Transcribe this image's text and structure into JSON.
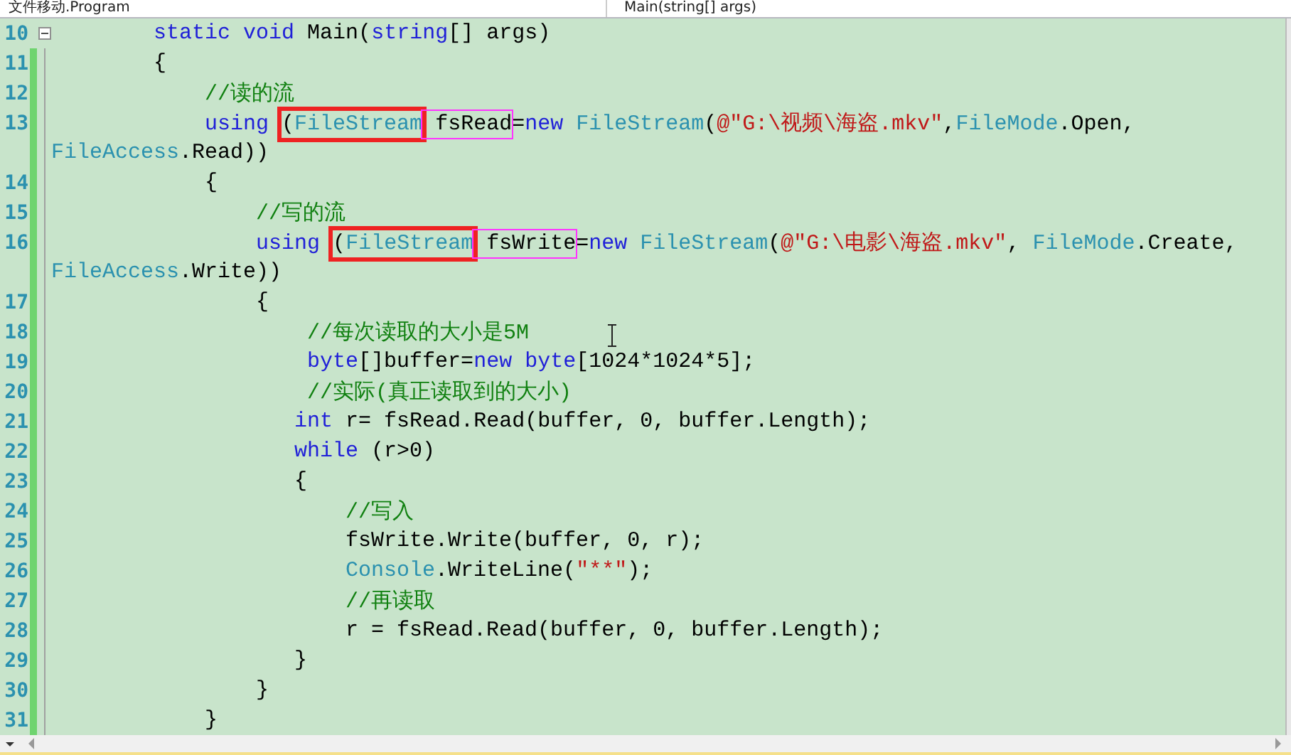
{
  "navigation_bar": {
    "type_dropdown": "文件移动.Program",
    "member_dropdown": "Main(string[] args)"
  },
  "code_rows": [
    {
      "number": "10",
      "collapsible": true,
      "modified": false,
      "tokens": [
        {
          "kind": "keyword",
          "text": "        static "
        },
        {
          "kind": "keyword",
          "text": "void"
        },
        {
          "kind": "plain",
          "text": " Main("
        },
        {
          "kind": "keyword",
          "text": "string"
        },
        {
          "kind": "plain",
          "text": "[] args)"
        }
      ]
    },
    {
      "number": "11",
      "collapsible": false,
      "modified": true,
      "tokens": [
        {
          "kind": "plain",
          "text": "        {"
        }
      ]
    },
    {
      "number": "12",
      "collapsible": false,
      "modified": true,
      "tokens": [
        {
          "kind": "comment",
          "text": "            //读的流"
        }
      ]
    },
    {
      "number": "13",
      "collapsible": false,
      "modified": true,
      "tokens": [
        {
          "kind": "keyword",
          "text": "            using "
        },
        {
          "kind": "frame",
          "color": "#ee2222",
          "tokens": [
            {
              "kind": "plain",
              "text": "("
            },
            {
              "kind": "type",
              "text": "FileStream"
            }
          ]
        },
        {
          "kind": "frame",
          "color": "#ff33ff",
          "tokens": [
            {
              "kind": "plain",
              "text": " fsRead"
            }
          ]
        },
        {
          "kind": "plain",
          "text": "="
        },
        {
          "kind": "keyword",
          "text": "new "
        },
        {
          "kind": "type",
          "text": "FileStream"
        },
        {
          "kind": "plain",
          "text": "("
        },
        {
          "kind": "string",
          "text": "@\"G:\\视频\\海盗.mkv\""
        },
        {
          "kind": "plain",
          "text": ","
        },
        {
          "kind": "type",
          "text": "FileMode"
        },
        {
          "kind": "plain",
          "text": ".Open,"
        }
      ]
    },
    {
      "modified": true,
      "tokens": [
        {
          "kind": "type",
          "text": "FileAccess"
        },
        {
          "kind": "plain",
          "text": ".Read))"
        }
      ]
    },
    {
      "number": "14",
      "collapsible": false,
      "modified": true,
      "tokens": [
        {
          "kind": "plain",
          "text": "            {"
        }
      ]
    },
    {
      "number": "15",
      "collapsible": false,
      "modified": true,
      "tokens": [
        {
          "kind": "comment",
          "text": "                //写的流"
        }
      ]
    },
    {
      "number": "16",
      "collapsible": false,
      "modified": true,
      "tokens": [
        {
          "kind": "keyword",
          "text": "                using "
        },
        {
          "kind": "frame",
          "color": "#ee2222",
          "tokens": [
            {
              "kind": "plain",
              "text": "("
            },
            {
              "kind": "type",
              "text": "FileStream"
            }
          ]
        },
        {
          "kind": "frame",
          "color": "#ff33ff",
          "tokens": [
            {
              "kind": "plain",
              "text": " fsWrite"
            }
          ]
        },
        {
          "kind": "plain",
          "text": "="
        },
        {
          "kind": "keyword",
          "text": "new "
        },
        {
          "kind": "type",
          "text": "FileStream"
        },
        {
          "kind": "plain",
          "text": "("
        },
        {
          "kind": "string",
          "text": "@\"G:\\电影\\海盗.mkv\""
        },
        {
          "kind": "plain",
          "text": ", "
        },
        {
          "kind": "type",
          "text": "FileMode"
        },
        {
          "kind": "plain",
          "text": ".Create,"
        }
      ]
    },
    {
      "modified": true,
      "tokens": [
        {
          "kind": "type",
          "text": "FileAccess"
        },
        {
          "kind": "plain",
          "text": ".Write))"
        }
      ]
    },
    {
      "number": "17",
      "collapsible": false,
      "modified": true,
      "tokens": [
        {
          "kind": "plain",
          "text": "                {"
        }
      ]
    },
    {
      "number": "18",
      "collapsible": false,
      "modified": true,
      "tokens": [
        {
          "kind": "comment",
          "text": "                    //每次读取的大小是5M"
        }
      ]
    },
    {
      "number": "19",
      "collapsible": false,
      "modified": true,
      "tokens": [
        {
          "kind": "keyword",
          "text": "                    byte"
        },
        {
          "kind": "plain",
          "text": "[]buffer="
        },
        {
          "kind": "keyword",
          "text": "new byte"
        },
        {
          "kind": "plain",
          "text": "[1024*1024*5];"
        }
      ]
    },
    {
      "number": "20",
      "collapsible": false,
      "modified": true,
      "tokens": [
        {
          "kind": "comment",
          "text": "                    //实际(真正读取到的大小)"
        }
      ]
    },
    {
      "number": "21",
      "collapsible": false,
      "modified": true,
      "tokens": [
        {
          "kind": "keyword",
          "text": "                   int"
        },
        {
          "kind": "plain",
          "text": " r= fsRead.Read(buffer, 0, buffer.Length);"
        }
      ]
    },
    {
      "number": "22",
      "collapsible": false,
      "modified": true,
      "tokens": [
        {
          "kind": "keyword",
          "text": "                   while"
        },
        {
          "kind": "plain",
          "text": " (r>0)"
        }
      ]
    },
    {
      "number": "23",
      "collapsible": false,
      "modified": true,
      "tokens": [
        {
          "kind": "plain",
          "text": "                   {"
        }
      ]
    },
    {
      "number": "24",
      "collapsible": false,
      "modified": true,
      "tokens": [
        {
          "kind": "comment",
          "text": "                       //写入"
        }
      ]
    },
    {
      "number": "25",
      "collapsible": false,
      "modified": true,
      "tokens": [
        {
          "kind": "plain",
          "text": "                       fsWrite.Write(buffer, 0, r);"
        }
      ]
    },
    {
      "number": "26",
      "collapsible": false,
      "modified": true,
      "tokens": [
        {
          "kind": "type",
          "text": "                       Console"
        },
        {
          "kind": "plain",
          "text": ".WriteLine("
        },
        {
          "kind": "string",
          "text": "\"**\""
        },
        {
          "kind": "plain",
          "text": ");"
        }
      ]
    },
    {
      "number": "27",
      "collapsible": false,
      "modified": true,
      "tokens": [
        {
          "kind": "comment",
          "text": "                       //再读取"
        }
      ]
    },
    {
      "number": "28",
      "collapsible": false,
      "modified": true,
      "tokens": [
        {
          "kind": "plain",
          "text": "                       r = fsRead.Read(buffer, 0, buffer.Length);"
        }
      ]
    },
    {
      "number": "29",
      "collapsible": false,
      "modified": true,
      "tokens": [
        {
          "kind": "plain",
          "text": "                   }"
        }
      ]
    },
    {
      "number": "30",
      "collapsible": false,
      "modified": true,
      "tokens": [
        {
          "kind": "plain",
          "text": "                }"
        }
      ]
    },
    {
      "number": "31",
      "collapsible": false,
      "modified": true,
      "tokens": [
        {
          "kind": "plain",
          "text": "            }"
        }
      ]
    }
  ]
}
